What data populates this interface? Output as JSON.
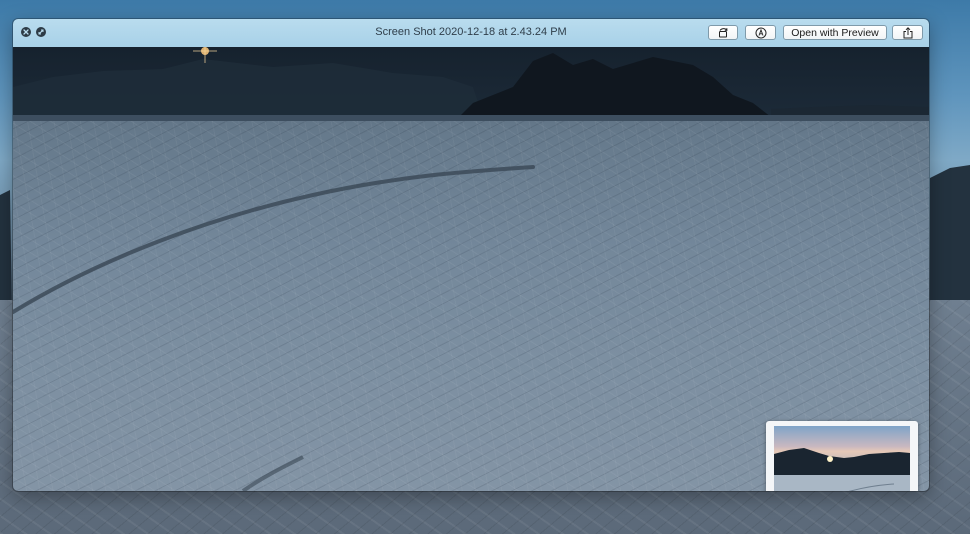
{
  "window": {
    "title": "Screen Shot 2020-12-18 at 2.43.24 PM",
    "close_icon": "close-icon",
    "fullscreen_icon": "fullscreen-icon"
  },
  "toolbar": {
    "rotate_icon": "rotate-icon",
    "markup_icon": "markup-icon",
    "open_with_preview_label": "Open with Preview",
    "share_icon": "share-icon"
  },
  "colors": {
    "titlebar": "#b1d6ea",
    "button_border": "#7f9aaa",
    "window_controls": "#2d3b46"
  }
}
